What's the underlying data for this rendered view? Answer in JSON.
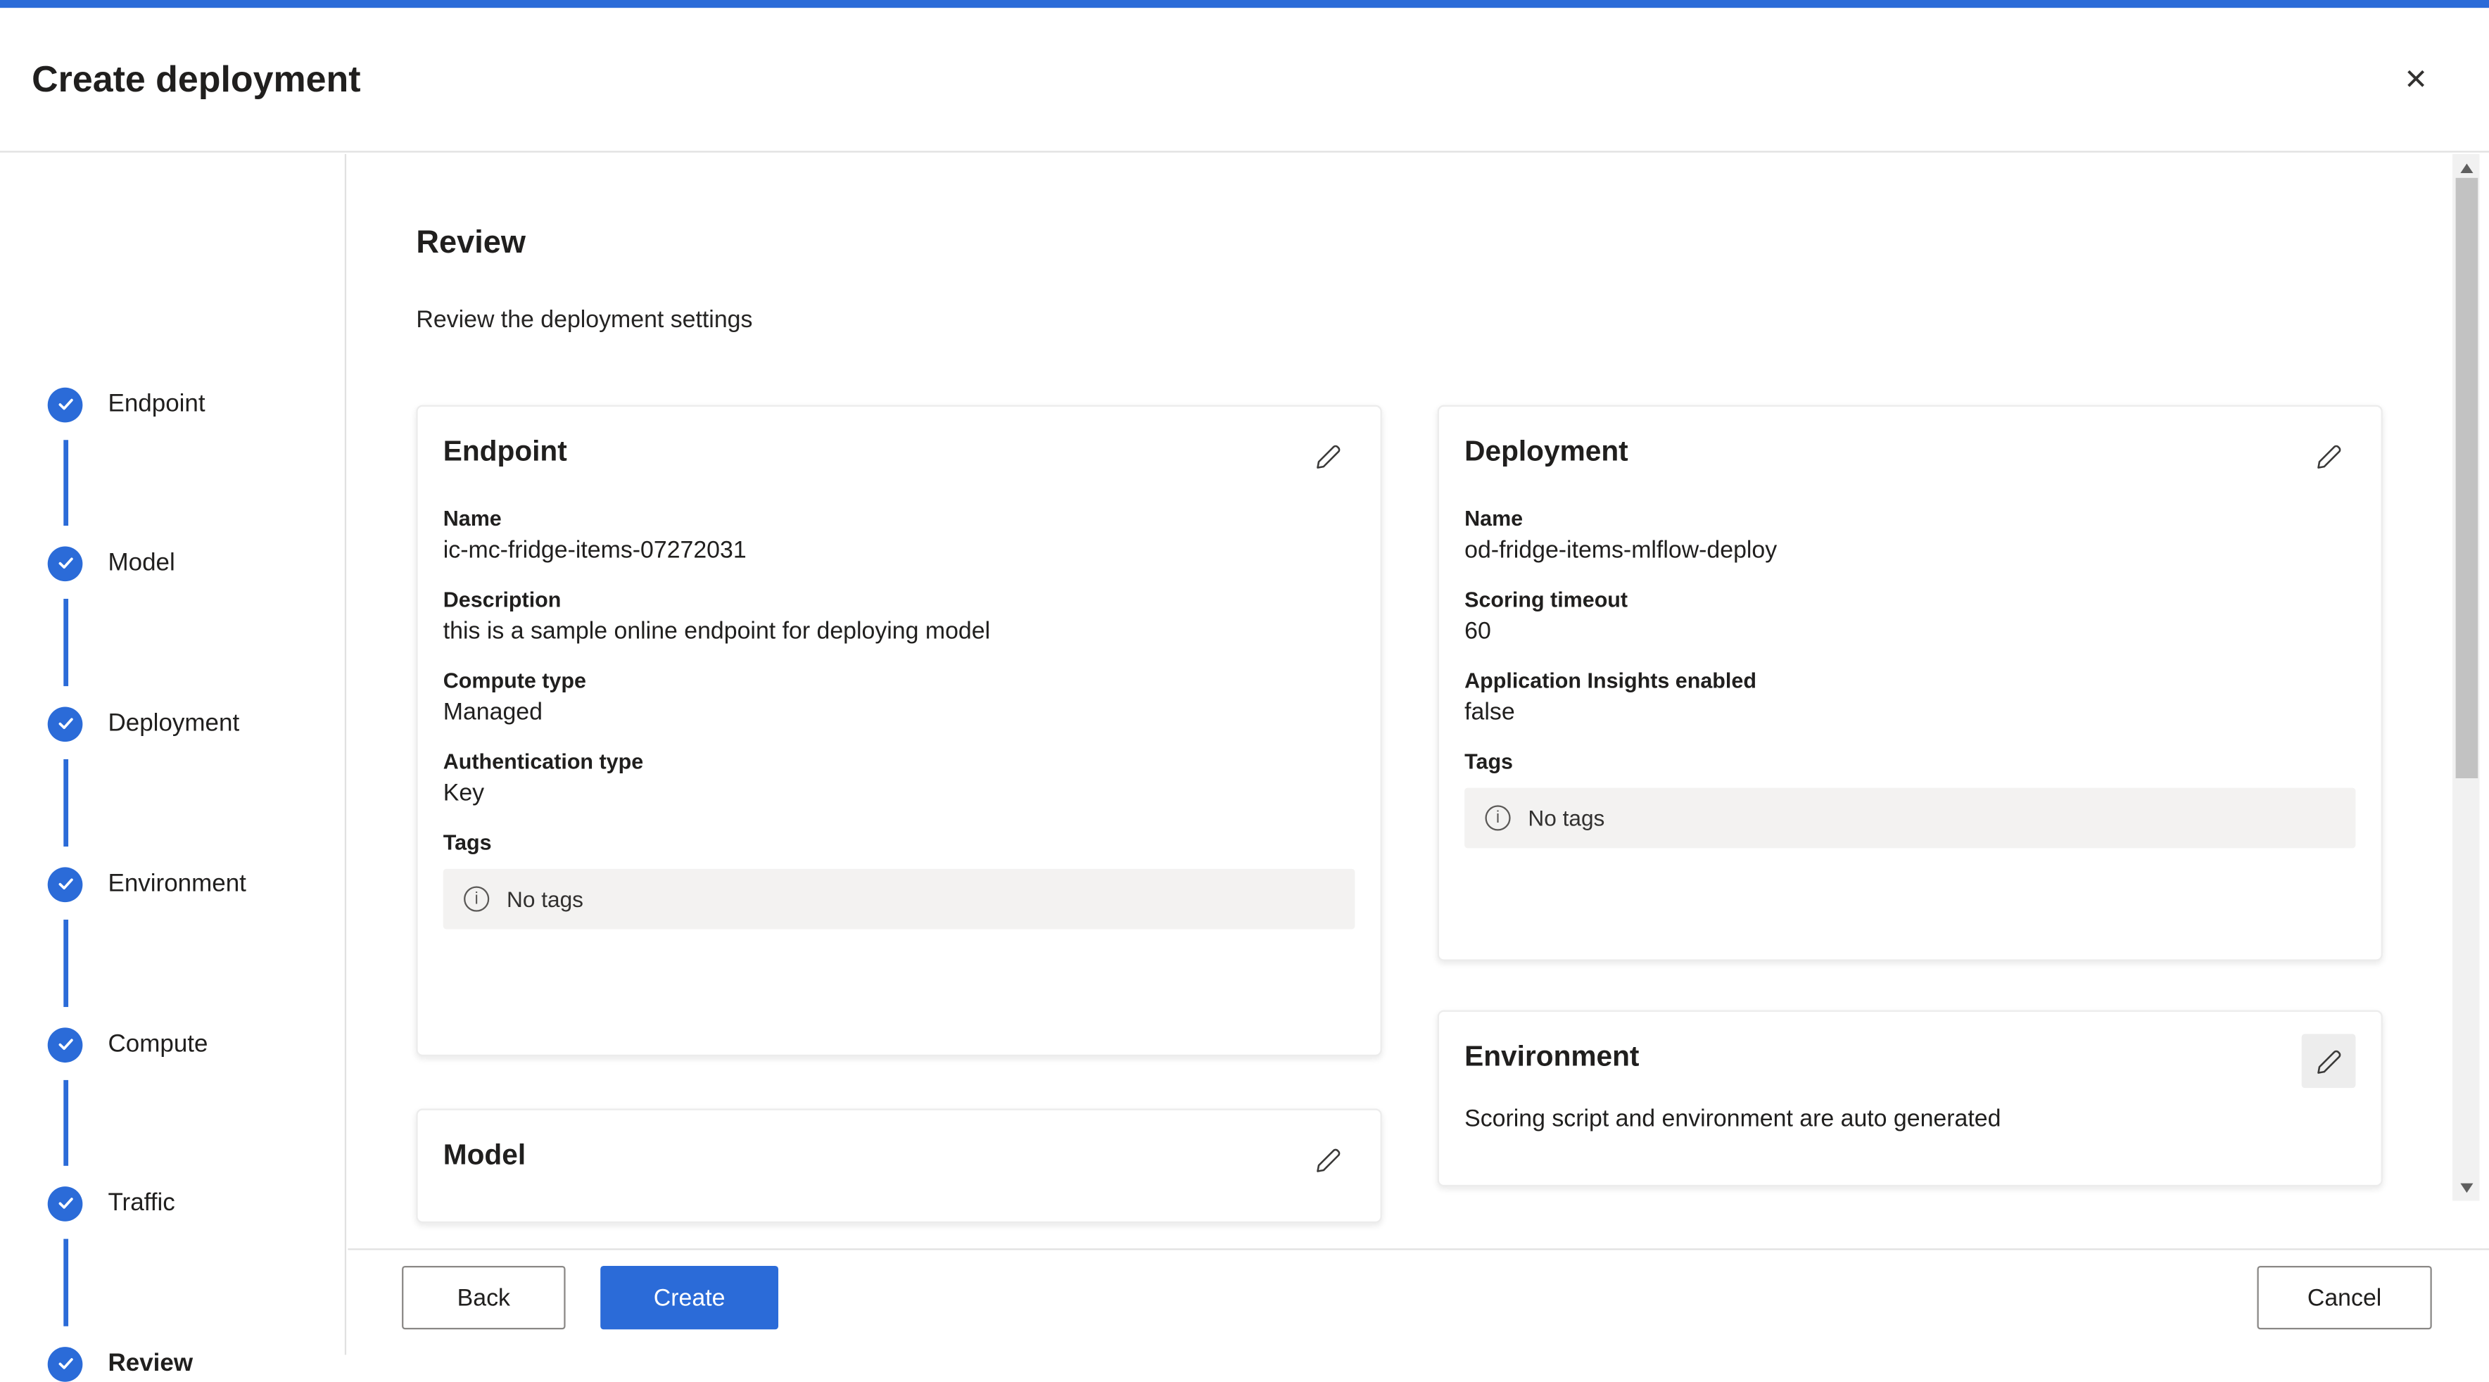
{
  "colors": {
    "accent": "#2b6bd8"
  },
  "dialog": {
    "title": "Create deployment"
  },
  "stepper": {
    "steps": [
      {
        "label": "Endpoint"
      },
      {
        "label": "Model"
      },
      {
        "label": "Deployment"
      },
      {
        "label": "Environment"
      },
      {
        "label": "Compute"
      },
      {
        "label": "Traffic"
      },
      {
        "label": "Review"
      }
    ]
  },
  "review": {
    "heading": "Review",
    "subheading": "Review the deployment settings"
  },
  "cards": {
    "endpoint": {
      "title": "Endpoint",
      "fields": [
        {
          "label": "Name",
          "value": "ic-mc-fridge-items-07272031"
        },
        {
          "label": "Description",
          "value": "this is a sample online endpoint for deploying model"
        },
        {
          "label": "Compute type",
          "value": "Managed"
        },
        {
          "label": "Authentication type",
          "value": "Key"
        }
      ],
      "tags": {
        "label": "Tags",
        "empty_text": "No tags"
      }
    },
    "model": {
      "title": "Model"
    },
    "deployment": {
      "title": "Deployment",
      "fields": [
        {
          "label": "Name",
          "value": "od-fridge-items-mlflow-deploy"
        },
        {
          "label": "Scoring timeout",
          "value": "60"
        },
        {
          "label": "Application Insights enabled",
          "value": "false"
        }
      ],
      "tags": {
        "label": "Tags",
        "empty_text": "No tags"
      }
    },
    "environment": {
      "title": "Environment",
      "description": "Scoring script and environment are auto generated"
    }
  },
  "footer": {
    "back": "Back",
    "create": "Create",
    "cancel": "Cancel"
  }
}
